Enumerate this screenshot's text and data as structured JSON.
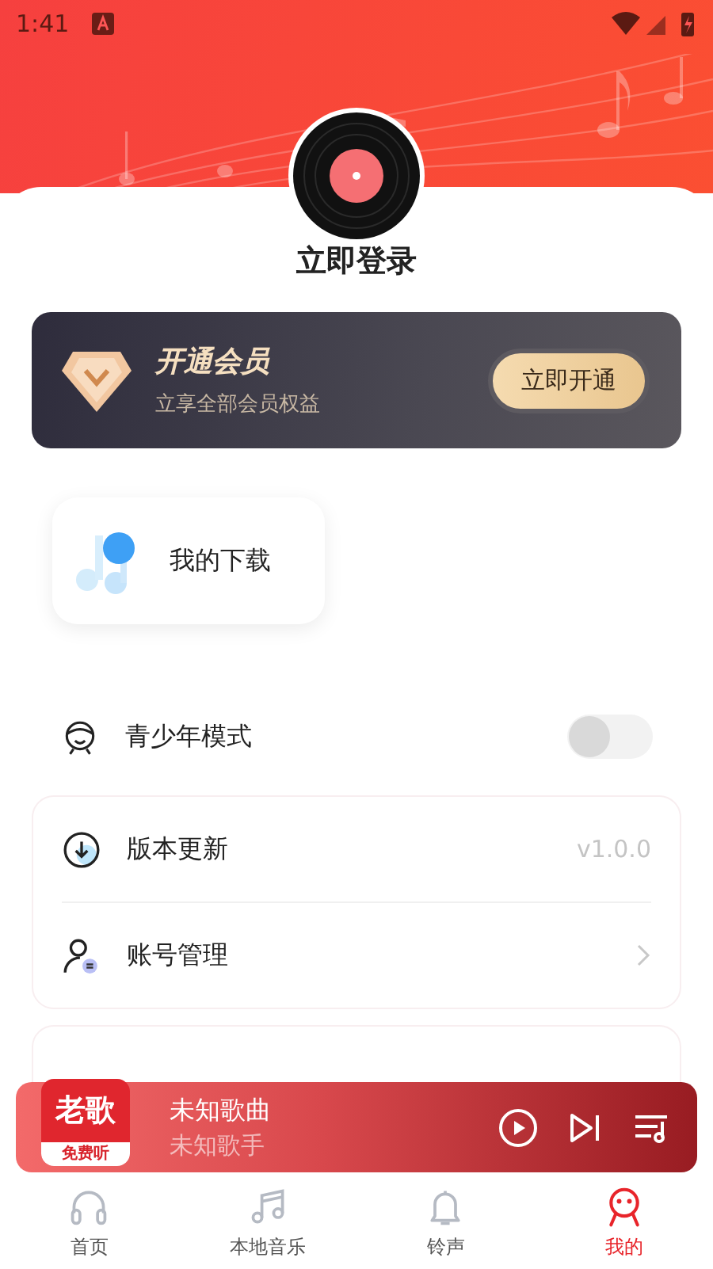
{
  "status_bar": {
    "time": "1:41"
  },
  "profile": {
    "login_label": "立即登录"
  },
  "vip_card": {
    "title": "开通会员",
    "subtitle": "立享全部会员权益",
    "button": "立即开通"
  },
  "shortcuts": [
    {
      "label": "我的下载"
    }
  ],
  "teen_mode": {
    "label": "青少年模式",
    "on": false
  },
  "setting_groups": [
    {
      "items": [
        {
          "kind": "value",
          "label": "版本更新",
          "value": "v1.0.0"
        },
        {
          "kind": "link",
          "label": "账号管理"
        }
      ]
    }
  ],
  "mini_player": {
    "cover_title": "老歌",
    "cover_badge": "免费听",
    "song": "未知歌曲",
    "artist": "未知歌手"
  },
  "tab_bar": [
    {
      "label": "首页",
      "selected": false
    },
    {
      "label": "本地音乐",
      "selected": false
    },
    {
      "label": "铃声",
      "selected": false
    },
    {
      "label": "我的",
      "selected": true
    }
  ]
}
